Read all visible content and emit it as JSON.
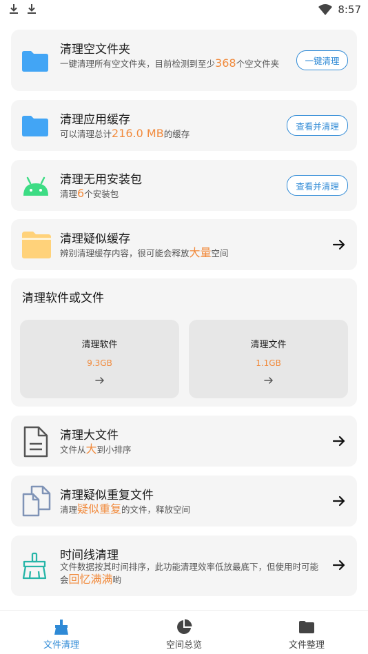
{
  "status_bar": {
    "time": "8:57",
    "icons": [
      "download-icon",
      "download-icon",
      "wifi-icon"
    ]
  },
  "cards": {
    "empty_folders": {
      "title": "清理空文件夹",
      "desc_prefix": "一键清理所有空文件夹，目前检测到至少",
      "desc_highlight": "368",
      "desc_suffix": "个空文件夹",
      "button": "一键清理",
      "icon": "folder-icon"
    },
    "app_cache": {
      "title": "清理应用缓存",
      "desc_prefix": "可以清理总计",
      "desc_highlight": "216.0 MB",
      "desc_suffix": "的缓存",
      "button": "查看并清理",
      "icon": "folder-icon"
    },
    "apk": {
      "title": "清理无用安装包",
      "desc_prefix": "清理",
      "desc_highlight": "6",
      "desc_suffix": "个安装包",
      "button": "查看并清理",
      "icon": "android-icon"
    },
    "suspect_cache": {
      "title": "清理疑似缓存",
      "desc_prefix": "辨别清理缓存内容，很可能会释放",
      "desc_highlight": "大量",
      "desc_suffix": "空间",
      "icon": "folder-open-icon"
    },
    "apps_files": {
      "title": "清理软件或文件",
      "software": {
        "title": "清理软件",
        "size": "9.3GB"
      },
      "files": {
        "title": "清理文件",
        "size": "1.1GB"
      }
    },
    "large_files": {
      "title": "清理大文件",
      "desc_prefix": "文件从",
      "desc_highlight": "大",
      "desc_suffix": "到小排序",
      "icon": "document-icon"
    },
    "duplicates": {
      "title": "清理疑似重复文件",
      "desc_prefix": "清理",
      "desc_highlight": "疑似重复",
      "desc_suffix": "的文件，释放空间",
      "icon": "duplicate-files-icon"
    },
    "timeline": {
      "title": "时间线清理",
      "desc_prefix": "文件数据按其时间排序，此功能清理效率低放最底下，但使用时可能会",
      "desc_highlight": "回忆满满",
      "desc_suffix": "哟",
      "icon": "broom-icon"
    }
  },
  "bottom_nav": [
    {
      "label": "文件清理",
      "icon": "broom-icon",
      "active": true
    },
    {
      "label": "空间总览",
      "icon": "pie-chart-icon",
      "active": false
    },
    {
      "label": "文件整理",
      "icon": "folder-icon",
      "active": false
    }
  ],
  "colors": {
    "accent": "#2f8ad6",
    "highlight": "#f18a3c",
    "card_bg": "#f5f5f5",
    "sub_card_bg": "#e7e7e7",
    "folder_blue": "#42a5f5",
    "android_green": "#3ddc84",
    "folder_yellow": "#ffd27a",
    "teal": "#26b5a8",
    "slate_blue": "#7f93b6"
  }
}
